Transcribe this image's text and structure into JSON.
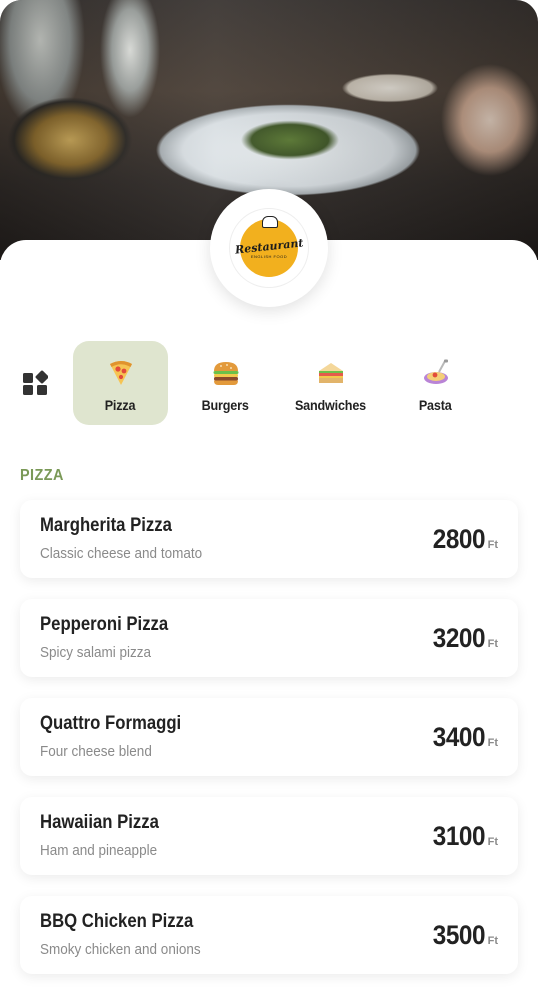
{
  "logo": {
    "script": "Restaurant",
    "sub": "ENGLISH FOOD"
  },
  "categories": [
    {
      "label": "Pizza",
      "icon": "pizza-icon",
      "active": true
    },
    {
      "label": "Burgers",
      "icon": "burger-icon",
      "active": false
    },
    {
      "label": "Sandwiches",
      "icon": "sandwich-icon",
      "active": false
    },
    {
      "label": "Pasta",
      "icon": "pasta-icon",
      "active": false
    }
  ],
  "section": {
    "title": "PIZZA"
  },
  "items": [
    {
      "name": "Margherita Pizza",
      "description": "Classic cheese and tomato",
      "price": "2800",
      "currency": "Ft"
    },
    {
      "name": "Pepperoni Pizza",
      "description": "Spicy salami pizza",
      "price": "3200",
      "currency": "Ft"
    },
    {
      "name": "Quattro Formaggi",
      "description": "Four cheese blend",
      "price": "3400",
      "currency": "Ft"
    },
    {
      "name": "Hawaiian Pizza",
      "description": "Ham and pineapple",
      "price": "3100",
      "currency": "Ft"
    },
    {
      "name": "BBQ Chicken Pizza",
      "description": "Smoky chicken and onions",
      "price": "3500",
      "currency": "Ft"
    }
  ],
  "colors": {
    "accent": "#7a9957",
    "active_tab": "#dfe5cf",
    "logo": "#f2b01e",
    "text": "#222222",
    "muted": "#8a8a8a"
  }
}
